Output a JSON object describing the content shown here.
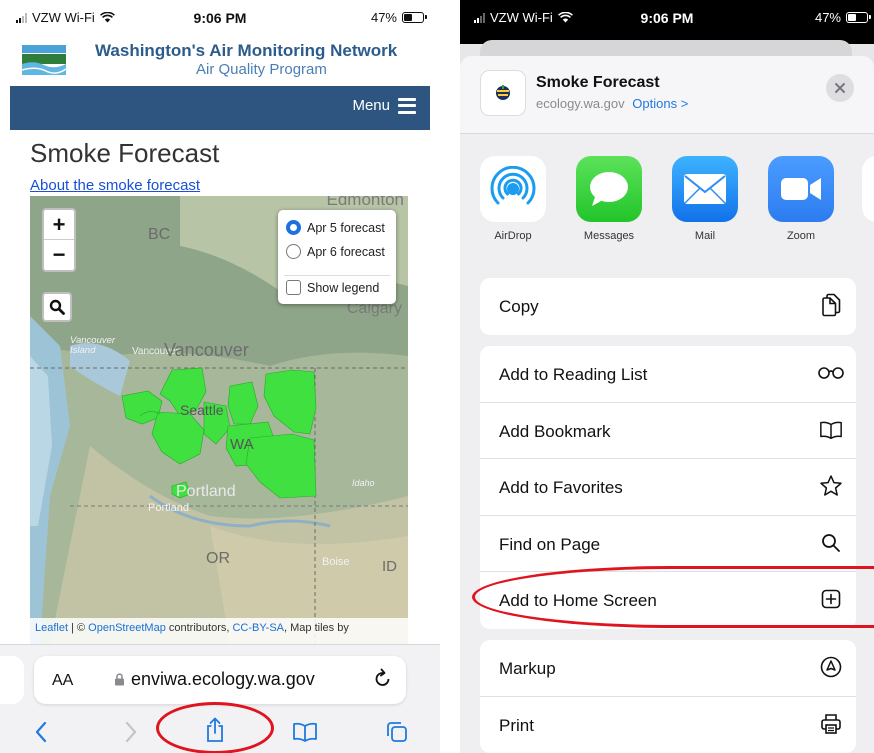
{
  "left": {
    "status_bar": {
      "carrier": "VZW Wi-Fi",
      "time": "9:06 PM",
      "battery_pct": "47%",
      "battery_level": 0.47
    },
    "site": {
      "title": "Washington's Air Monitoring Network",
      "subtitle": "Air Quality Program",
      "menu_label": "Menu"
    },
    "page": {
      "title": "Smoke Forecast",
      "about_link": "About the smoke forecast"
    },
    "map": {
      "places": {
        "edmonton": "Edmonton",
        "bc": "BC",
        "calgary": "Calgary",
        "vancouver_island": "Vancouver Island",
        "vancouver_small": "Vancouver",
        "vancouver": "Vancouver",
        "seattle": "Seattle",
        "wa": "WA",
        "portland_big": "Portland",
        "portland": "Portland",
        "or": "OR",
        "boise": "Boise",
        "id": "ID",
        "idaho": "Idaho"
      },
      "zoom_in": "+",
      "zoom_out": "−",
      "forecast_options": [
        "Apr 5 forecast",
        "Apr 6 forecast"
      ],
      "selected_forecast": "Apr 5 forecast",
      "show_legend": "Show legend",
      "attribution": {
        "leaflet": "Leaflet",
        "sep1": " | © ",
        "osm": "OpenStreetMap",
        "contributors": " contributors, ",
        "license": "CC-BY-SA",
        "tiles": ", Map tiles by"
      },
      "smoke_color": "#3fe03f"
    },
    "toolbar": {
      "text_size": "AA",
      "url": "enviwa.ecology.wa.gov"
    }
  },
  "right": {
    "status_bar": {
      "carrier": "VZW Wi-Fi",
      "time": "9:06 PM",
      "battery_pct": "47%",
      "battery_level": 0.47
    },
    "share_header": {
      "title": "Smoke Forecast",
      "domain": "ecology.wa.gov",
      "options": "Options >"
    },
    "apps": [
      {
        "label": "AirDrop",
        "icon": "airdrop-icon"
      },
      {
        "label": "Messages",
        "icon": "messages-icon"
      },
      {
        "label": "Mail",
        "icon": "mail-icon"
      },
      {
        "label": "Zoom",
        "icon": "zoom-icon"
      }
    ],
    "actions": {
      "copy": "Copy",
      "reading_list": "Add to Reading List",
      "bookmark": "Add Bookmark",
      "favorites": "Add to Favorites",
      "find": "Find on Page",
      "home_screen": "Add to Home Screen",
      "markup": "Markup",
      "print": "Print"
    }
  },
  "colors": {
    "accent": "#1f7ae0",
    "highlight_ring": "#e0141e",
    "nav_bar": "#2d5580",
    "header_text": "#2c5c8c"
  }
}
